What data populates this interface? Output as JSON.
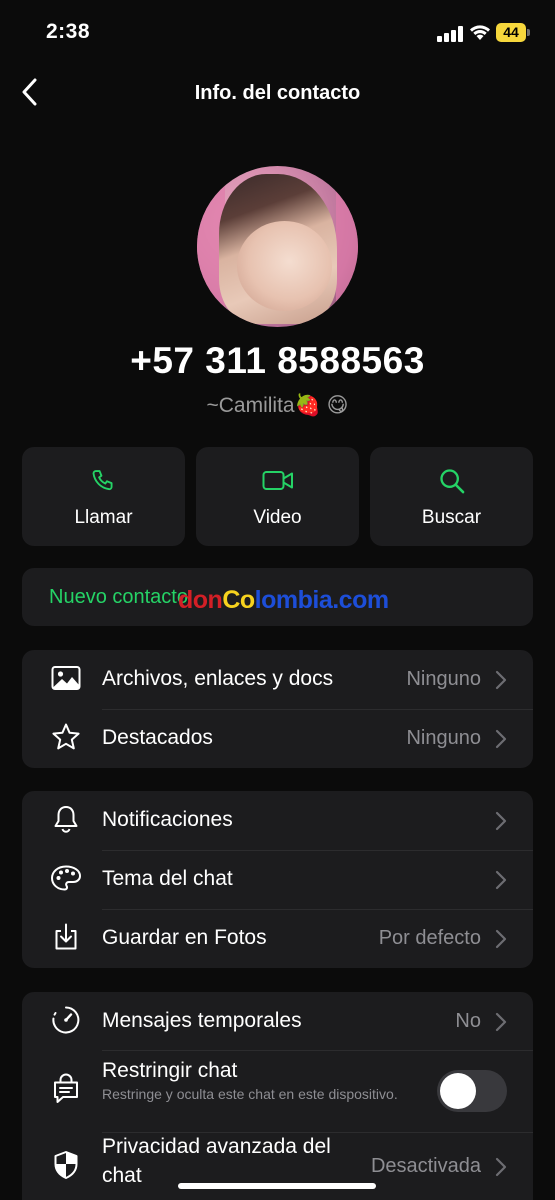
{
  "status_bar": {
    "time": "2:38",
    "battery": "44"
  },
  "nav": {
    "title": "Info. del contacto",
    "back_icon": "chevron-left-icon"
  },
  "contact": {
    "phone": "+57 311 8588563",
    "name": "~Camilita🍓 😋"
  },
  "actions": [
    {
      "label": "Llamar",
      "icon": "phone-icon"
    },
    {
      "label": "Video",
      "icon": "video-icon"
    },
    {
      "label": "Buscar",
      "icon": "search-icon"
    }
  ],
  "new_contact": {
    "label": "Nuevo contacto"
  },
  "watermark": {
    "part1": "don",
    "part2": "Co",
    "part3": "lombia.com"
  },
  "media_section": [
    {
      "label": "Archivos, enlaces y docs",
      "value": "Ninguno",
      "icon": "image-icon"
    },
    {
      "label": "Destacados",
      "value": "Ninguno",
      "icon": "star-icon"
    }
  ],
  "settings_section": [
    {
      "label": "Notificaciones",
      "value": "",
      "icon": "bell-icon"
    },
    {
      "label": "Tema del chat",
      "value": "",
      "icon": "palette-icon"
    },
    {
      "label": "Guardar en Fotos",
      "value": "Por defecto",
      "icon": "download-icon"
    }
  ],
  "privacy_section": {
    "temporal": {
      "label": "Mensajes temporales",
      "value": "No",
      "icon": "timer-icon"
    },
    "restrict": {
      "label": "Restringir chat",
      "description": "Restringe y oculta este chat en este dispositivo.",
      "enabled": false,
      "icon": "locked-chat-icon"
    },
    "advanced": {
      "label": "Privacidad avanzada del chat",
      "value": "Desactivada",
      "icon": "shield-icon"
    }
  },
  "colors": {
    "accent": "#25d366",
    "card": "#1c1c1e",
    "background": "#0b0b0b",
    "secondary_text": "#8e8e93"
  }
}
